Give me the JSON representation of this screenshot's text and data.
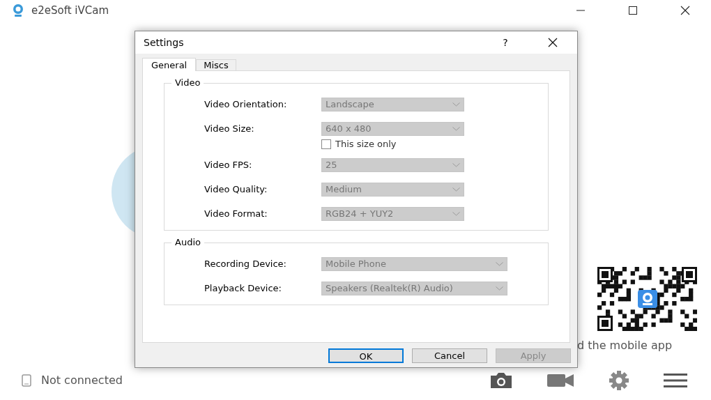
{
  "window": {
    "title": "e2eSoft iVCam",
    "controls": [
      {
        "kind": "minimize"
      },
      {
        "kind": "maximize"
      },
      {
        "kind": "close"
      }
    ]
  },
  "qr_caption": "d the mobile app",
  "status_bar": {
    "text": "Not connected"
  },
  "toolbar": [
    {
      "kind": "camera"
    },
    {
      "kind": "video"
    },
    {
      "kind": "settings"
    },
    {
      "kind": "menu"
    }
  ],
  "dialog": {
    "title": "Settings",
    "help": "?",
    "tabs": [
      {
        "label": "General",
        "selected": true
      },
      {
        "label": "Miscs",
        "selected": false
      }
    ],
    "groups": [
      {
        "title": "Video",
        "fields": [
          {
            "kind": "combo",
            "label": "Video Orientation:",
            "value": "Landscape",
            "disabled": true
          },
          {
            "kind": "combo",
            "label": "Video Size:",
            "value": "640 x 480",
            "disabled": true
          },
          {
            "kind": "checkbox",
            "label": "This size only",
            "checked": false
          },
          {
            "kind": "combo",
            "label": "Video FPS:",
            "value": "25",
            "disabled": true
          },
          {
            "kind": "combo",
            "label": "Video Quality:",
            "value": "Medium",
            "disabled": true
          },
          {
            "kind": "combo",
            "label": "Video Format:",
            "value": "RGB24 + YUY2",
            "disabled": true
          }
        ]
      },
      {
        "title": "Audio",
        "fields": [
          {
            "kind": "combo",
            "label": "Recording Device:",
            "value": "Mobile Phone",
            "disabled": true
          },
          {
            "kind": "combo",
            "label": "Playback Device:",
            "value": "Speakers (Realtek(R) Audio)",
            "disabled": true
          }
        ]
      }
    ],
    "buttons": [
      {
        "label": "OK",
        "default": true,
        "disabled": false
      },
      {
        "label": "Cancel",
        "default": false,
        "disabled": false
      },
      {
        "label": "Apply",
        "default": false,
        "disabled": true
      }
    ]
  }
}
